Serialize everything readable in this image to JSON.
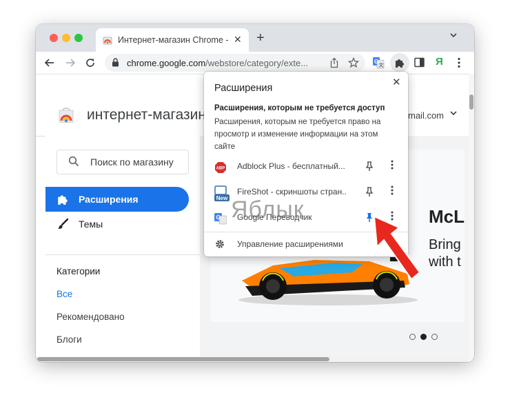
{
  "browser": {
    "tab_title": "Интернет-магазин Chrome - Е",
    "tab_close": "✕",
    "new_tab": "+",
    "url_host": "chrome.google.com",
    "url_path": "/webstore/category/exte...",
    "traffic_colors": [
      "#ff5f57",
      "#febc2e",
      "#28c840"
    ]
  },
  "store": {
    "title": "интернет-магазин",
    "account": "mail.com",
    "search_placeholder": "Поиск по магазину",
    "nav": [
      {
        "label": "Расширения",
        "active": true
      },
      {
        "label": "Темы",
        "active": false
      }
    ],
    "categories_heading": "Категории",
    "categories": [
      {
        "label": "Все",
        "selected": true
      },
      {
        "label": "Рекомендовано",
        "selected": false
      },
      {
        "label": "Блоги",
        "selected": false
      }
    ],
    "banner": {
      "title": "McL",
      "line1": "Bring",
      "line2": "with t"
    },
    "carousel_active": 2
  },
  "popup": {
    "title": "Расширения",
    "subtitle": "Расширения, которым не требуется доступ",
    "description": "Расширения, которым не требуется право на просмотр и изменение информации на этом сайте",
    "extensions": [
      {
        "name": "Adblock Plus - бесплатный...",
        "icon": "adblock-icon",
        "pinned": false
      },
      {
        "name": "FireShot - скриншоты стран...",
        "icon": "fireshot-icon",
        "pinned": false,
        "badge": "New"
      },
      {
        "name": "Google Переводчик",
        "icon": "google-translate-icon",
        "pinned": true
      }
    ],
    "manage_label": "Управление расширениями"
  },
  "watermark": "Яблык",
  "yandex_letter": "Я",
  "accent": "#1a73e8",
  "arrow_color": "#e8281e"
}
